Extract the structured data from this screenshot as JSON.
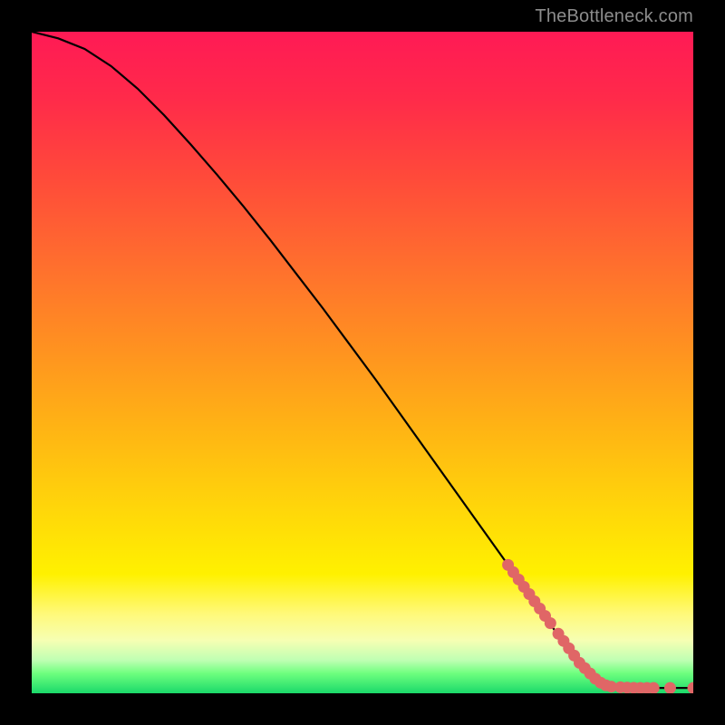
{
  "attribution": "TheBottleneck.com",
  "chart_data": {
    "type": "line",
    "title": "",
    "xlabel": "",
    "ylabel": "",
    "xlim": [
      0,
      100
    ],
    "ylim": [
      0,
      100
    ],
    "curve": {
      "x": [
        0,
        4,
        8,
        12,
        16,
        20,
        24,
        28,
        32,
        36,
        40,
        44,
        48,
        52,
        56,
        60,
        64,
        68,
        72,
        76,
        80,
        84,
        86,
        88,
        90,
        92,
        94,
        96,
        98,
        100
      ],
      "y": [
        100,
        99.0,
        97.4,
        94.8,
        91.4,
        87.4,
        83.0,
        78.4,
        73.6,
        68.6,
        63.4,
        58.2,
        52.8,
        47.4,
        41.8,
        36.2,
        30.6,
        25.0,
        19.4,
        13.8,
        8.2,
        3.4,
        1.8,
        1.0,
        0.8,
        0.8,
        0.8,
        0.8,
        0.8,
        0.8
      ]
    },
    "highlight_points": {
      "x": [
        72.0,
        72.8,
        73.6,
        74.4,
        75.2,
        76.0,
        76.8,
        77.6,
        78.4,
        79.6,
        80.4,
        81.2,
        82.0,
        82.8,
        83.6,
        84.4,
        85.2,
        86.0,
        86.8,
        87.6,
        89.0,
        90.0,
        91.0,
        92.0,
        93.0,
        94.0,
        96.5,
        100.0
      ],
      "y": [
        19.4,
        18.3,
        17.2,
        16.1,
        15.0,
        13.9,
        12.8,
        11.7,
        10.6,
        9.0,
        7.9,
        6.8,
        5.7,
        4.6,
        3.8,
        3.0,
        2.2,
        1.6,
        1.2,
        1.0,
        0.9,
        0.85,
        0.82,
        0.8,
        0.8,
        0.8,
        0.8,
        0.8
      ]
    },
    "colors": {
      "curve": "#000000",
      "points": "#e06666",
      "background_top": "#ff1a55",
      "background_bottom": "#1ad96a"
    }
  }
}
